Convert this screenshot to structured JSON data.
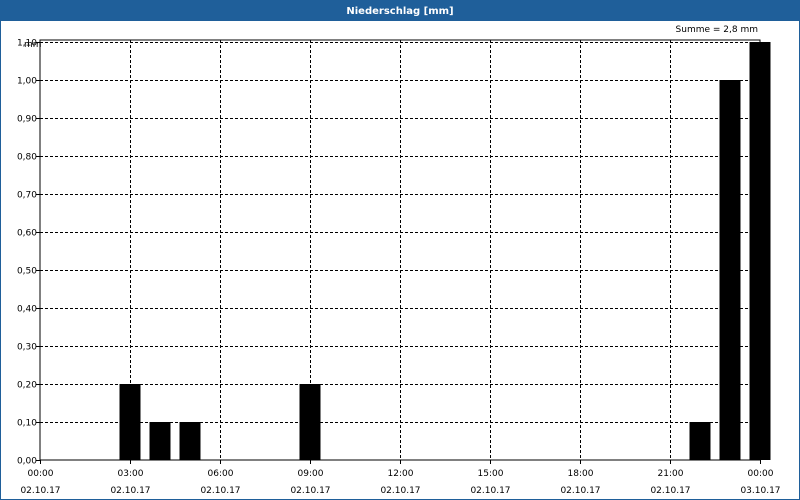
{
  "window": {
    "title": "Niederschlag [mm]"
  },
  "summary": {
    "text": "Summe = 2,8 mm"
  },
  "chart_data": {
    "type": "bar",
    "title": "Niederschlag [mm]",
    "ylabel": "mm",
    "xlabel": "",
    "ylim": [
      0,
      1.1
    ],
    "grid": true,
    "xlim": [
      "02.10.17 00:00",
      "03.10.17 00:00"
    ],
    "categories": [
      "03:00",
      "04:00",
      "05:00",
      "09:00",
      "22:00",
      "23:00",
      "00:00"
    ],
    "timestamps_hours": [
      3,
      4,
      5,
      9,
      22,
      23,
      24
    ],
    "values": [
      0.2,
      0.1,
      0.1,
      0.2,
      0.1,
      1.0,
      1.1
    ],
    "y_ticks": [
      "0,00",
      "0,10",
      "0,20",
      "0,30",
      "0,40",
      "0,50",
      "0,60",
      "0,70",
      "0,80",
      "0,90",
      "1,00",
      "1,10"
    ],
    "x_ticks": [
      {
        "hours": 0,
        "time": "00:00",
        "date": "02.10.17"
      },
      {
        "hours": 3,
        "time": "03:00",
        "date": "02.10.17"
      },
      {
        "hours": 6,
        "time": "06:00",
        "date": "02.10.17"
      },
      {
        "hours": 9,
        "time": "09:00",
        "date": "02.10.17"
      },
      {
        "hours": 12,
        "time": "12:00",
        "date": "02.10.17"
      },
      {
        "hours": 15,
        "time": "15:00",
        "date": "02.10.17"
      },
      {
        "hours": 18,
        "time": "18:00",
        "date": "02.10.17"
      },
      {
        "hours": 21,
        "time": "21:00",
        "date": "02.10.17"
      },
      {
        "hours": 24,
        "time": "00:00",
        "date": "03.10.17"
      }
    ],
    "colors": {
      "bar": "#000000",
      "grid": "#000000",
      "header": "#1f5f9a"
    }
  }
}
